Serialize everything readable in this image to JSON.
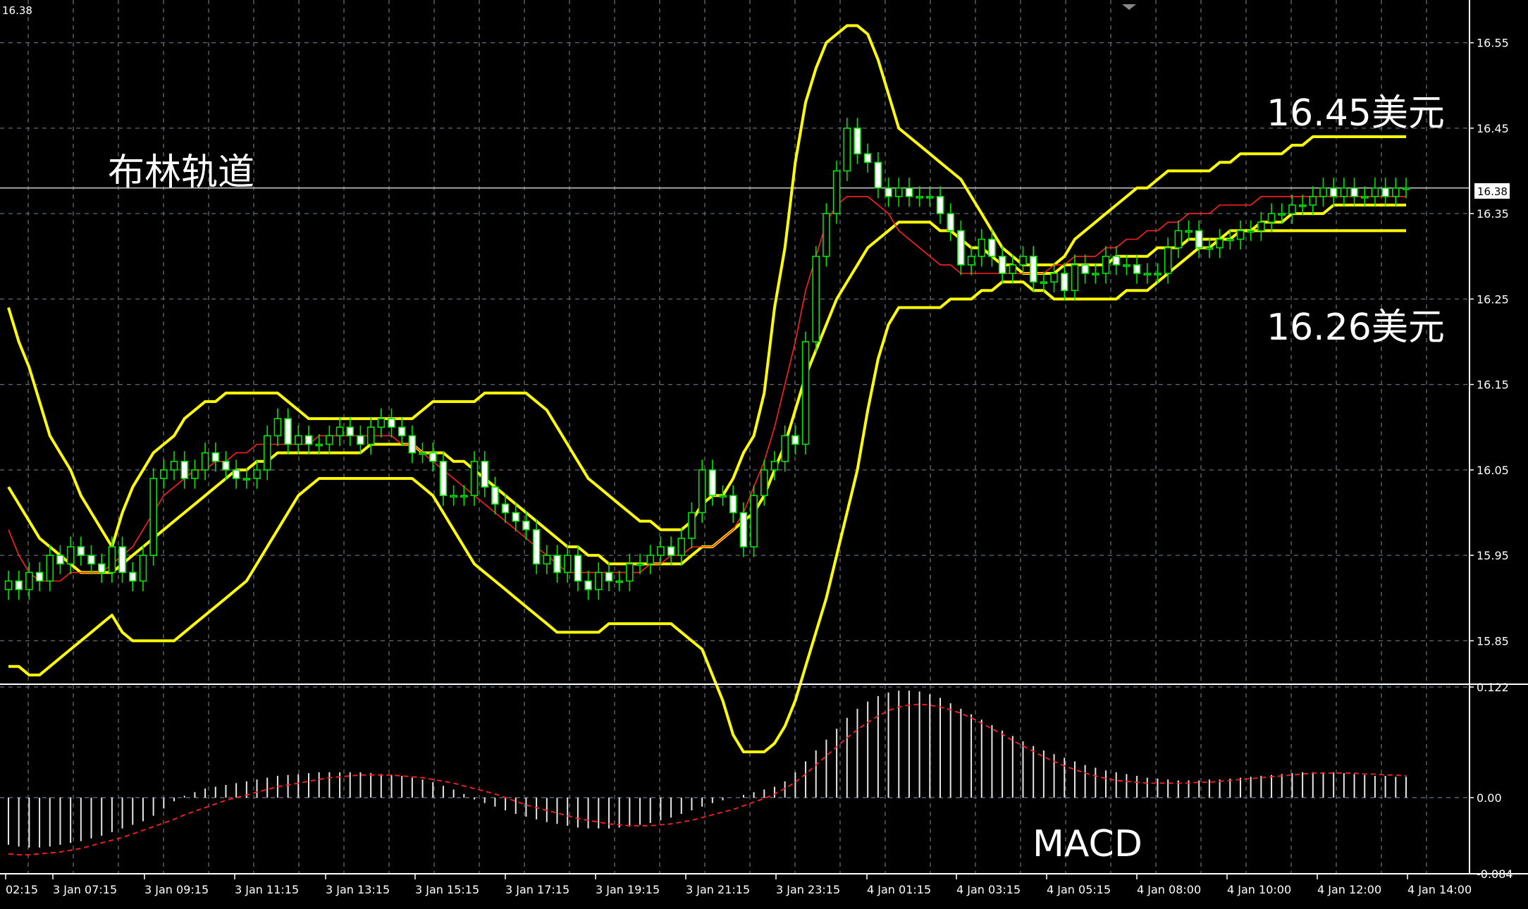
{
  "chart_data": [
    {
      "type": "candlestick",
      "corner_label": "16.38",
      "current_price": "16.38",
      "annotations": {
        "bollinger": "布林轨道",
        "upper_value": "16.45美元",
        "lower_value": "16.26美元"
      },
      "y_axis": {
        "range": [
          15.8,
          16.6
        ],
        "ticks": [
          "16.55",
          "16.45",
          "16.35",
          "16.25",
          "16.15",
          "16.05",
          "15.95",
          "15.85"
        ]
      },
      "x_axis": {
        "ticks": [
          "02:15",
          "3 Jan 07:15",
          "3 Jan 09:15",
          "3 Jan 11:15",
          "3 Jan 13:15",
          "3 Jan 15:15",
          "3 Jan 17:15",
          "3 Jan 19:15",
          "3 Jan 21:15",
          "3 Jan 23:15",
          "4 Jan 01:15",
          "4 Jan 03:15",
          "4 Jan 05:15",
          "4 Jan 08:00",
          "4 Jan 10:00",
          "4 Jan 12:00",
          "4 Jan 14:00"
        ]
      },
      "close": [
        15.92,
        15.91,
        15.93,
        15.92,
        15.95,
        15.94,
        15.96,
        15.95,
        15.94,
        15.93,
        15.96,
        15.93,
        15.92,
        15.95,
        16.04,
        16.05,
        16.06,
        16.04,
        16.05,
        16.07,
        16.06,
        16.05,
        16.04,
        16.04,
        16.05,
        16.09,
        16.11,
        16.08,
        16.09,
        16.08,
        16.08,
        16.09,
        16.1,
        16.09,
        16.08,
        16.1,
        16.11,
        16.1,
        16.09,
        16.07,
        16.07,
        16.06,
        16.02,
        16.02,
        16.02,
        16.06,
        16.03,
        16.01,
        16.0,
        15.99,
        15.98,
        15.94,
        15.95,
        15.93,
        15.95,
        15.92,
        15.91,
        15.93,
        15.92,
        15.92,
        15.94,
        15.94,
        15.95,
        15.96,
        15.95,
        15.97,
        16.0,
        16.05,
        16.02,
        16.02,
        16.0,
        15.96,
        16.02,
        16.05,
        16.06,
        16.09,
        16.08,
        16.2,
        16.3,
        16.35,
        16.4,
        16.45,
        16.42,
        16.41,
        16.38,
        16.37,
        16.38,
        16.37,
        16.37,
        16.37,
        16.35,
        16.33,
        16.29,
        16.3,
        16.32,
        16.3,
        16.28,
        16.29,
        16.3,
        16.27,
        16.27,
        16.28,
        16.26,
        16.29,
        16.28,
        16.28,
        16.3,
        16.29,
        16.29,
        16.28,
        16.28,
        16.28,
        16.31,
        16.33,
        16.33,
        16.31,
        16.31,
        16.32,
        16.32,
        16.33,
        16.33,
        16.34,
        16.35,
        16.35,
        16.36,
        16.36,
        16.37,
        16.38,
        16.37,
        16.38,
        16.37,
        16.37,
        16.38,
        16.37,
        16.38,
        16.38
      ],
      "series": [
        {
          "name": "upper",
          "color": "#ffff00",
          "values": [
            16.24,
            16.2,
            16.17,
            16.13,
            16.09,
            16.07,
            16.05,
            16.02,
            16.0,
            15.98,
            15.96,
            16.0,
            16.03,
            16.05,
            16.07,
            16.08,
            16.09,
            16.11,
            16.12,
            16.13,
            16.13,
            16.14,
            16.14,
            16.14,
            16.14,
            16.14,
            16.14,
            16.13,
            16.12,
            16.11,
            16.11,
            16.11,
            16.11,
            16.11,
            16.11,
            16.11,
            16.11,
            16.11,
            16.11,
            16.11,
            16.12,
            16.13,
            16.13,
            16.13,
            16.13,
            16.13,
            16.14,
            16.14,
            16.14,
            16.14,
            16.14,
            16.13,
            16.12,
            16.1,
            16.08,
            16.06,
            16.04,
            16.03,
            16.02,
            16.01,
            16.0,
            15.99,
            15.99,
            15.98,
            15.98,
            15.98,
            15.99,
            16.01,
            16.02,
            16.02,
            16.04,
            16.07,
            16.09,
            16.14,
            16.24,
            16.31,
            16.41,
            16.48,
            16.52,
            16.55,
            16.56,
            16.57,
            16.57,
            16.56,
            16.53,
            16.49,
            16.45,
            16.44,
            16.43,
            16.42,
            16.41,
            16.4,
            16.39,
            16.37,
            16.35,
            16.33,
            16.31,
            16.3,
            16.29,
            16.29,
            16.29,
            16.29,
            16.3,
            16.32,
            16.33,
            16.34,
            16.35,
            16.36,
            16.37,
            16.38,
            16.38,
            16.39,
            16.4,
            16.4,
            16.4,
            16.4,
            16.4,
            16.41,
            16.41,
            16.42,
            16.42,
            16.42,
            16.42,
            16.42,
            16.43,
            16.43,
            16.44,
            16.44,
            16.44,
            16.44,
            16.44,
            16.44,
            16.44,
            16.44,
            16.44,
            16.44
          ]
        },
        {
          "name": "middle",
          "color": "#ffff00",
          "values": [
            16.03,
            16.01,
            15.99,
            15.97,
            15.96,
            15.95,
            15.94,
            15.93,
            15.93,
            15.93,
            15.93,
            15.94,
            15.95,
            15.96,
            15.97,
            15.98,
            15.99,
            16.0,
            16.01,
            16.02,
            16.03,
            16.04,
            16.05,
            16.05,
            16.06,
            16.06,
            16.07,
            16.07,
            16.07,
            16.07,
            16.07,
            16.07,
            16.07,
            16.07,
            16.07,
            16.08,
            16.08,
            16.08,
            16.08,
            16.08,
            16.07,
            16.07,
            16.07,
            16.06,
            16.06,
            16.05,
            16.04,
            16.03,
            16.02,
            16.01,
            16.0,
            15.99,
            15.98,
            15.97,
            15.96,
            15.96,
            15.95,
            15.95,
            15.94,
            15.94,
            15.94,
            15.94,
            15.94,
            15.94,
            15.94,
            15.94,
            15.95,
            15.96,
            15.96,
            15.97,
            15.98,
            15.99,
            16.0,
            16.02,
            16.05,
            16.08,
            16.12,
            16.16,
            16.19,
            16.22,
            16.25,
            16.27,
            16.29,
            16.31,
            16.32,
            16.33,
            16.34,
            16.34,
            16.34,
            16.34,
            16.33,
            16.33,
            16.32,
            16.31,
            16.31,
            16.3,
            16.29,
            16.29,
            16.28,
            16.28,
            16.28,
            16.28,
            16.29,
            16.29,
            16.29,
            16.29,
            16.29,
            16.3,
            16.3,
            16.3,
            16.3,
            16.31,
            16.31,
            16.31,
            16.32,
            16.32,
            16.32,
            16.32,
            16.33,
            16.33,
            16.33,
            16.34,
            16.34,
            16.34,
            16.35,
            16.35,
            16.35,
            16.35,
            16.36,
            16.36,
            16.36,
            16.36,
            16.36,
            16.36,
            16.36,
            16.36
          ]
        },
        {
          "name": "lower",
          "color": "#ffff00",
          "values": [
            15.82,
            15.82,
            15.81,
            15.81,
            15.82,
            15.83,
            15.84,
            15.85,
            15.86,
            15.87,
            15.88,
            15.86,
            15.85,
            15.85,
            15.85,
            15.85,
            15.85,
            15.86,
            15.87,
            15.88,
            15.89,
            15.9,
            15.91,
            15.92,
            15.94,
            15.96,
            15.98,
            16.0,
            16.02,
            16.03,
            16.04,
            16.04,
            16.04,
            16.04,
            16.04,
            16.04,
            16.04,
            16.04,
            16.04,
            16.04,
            16.03,
            16.02,
            16.0,
            15.98,
            15.96,
            15.94,
            15.93,
            15.92,
            15.91,
            15.9,
            15.89,
            15.88,
            15.87,
            15.86,
            15.86,
            15.86,
            15.86,
            15.86,
            15.87,
            15.87,
            15.87,
            15.87,
            15.87,
            15.87,
            15.87,
            15.86,
            15.85,
            15.84,
            15.81,
            15.78,
            15.74,
            15.72,
            15.72,
            15.72,
            15.73,
            15.75,
            15.78,
            15.82,
            15.86,
            15.9,
            15.95,
            16.0,
            16.05,
            16.12,
            16.18,
            16.22,
            16.24,
            16.24,
            16.24,
            16.24,
            16.24,
            16.25,
            16.25,
            16.25,
            16.26,
            16.26,
            16.27,
            16.27,
            16.27,
            16.26,
            16.26,
            16.25,
            16.25,
            16.25,
            16.25,
            16.25,
            16.25,
            16.25,
            16.26,
            16.26,
            16.26,
            16.27,
            16.28,
            16.29,
            16.3,
            16.31,
            16.31,
            16.32,
            16.32,
            16.33,
            16.33,
            16.33,
            16.33,
            16.33,
            16.33,
            16.33,
            16.33,
            16.33,
            16.33,
            16.33,
            16.33,
            16.33,
            16.33,
            16.33,
            16.33,
            16.33
          ]
        },
        {
          "name": "ma",
          "color": "#ff2020",
          "values": [
            15.98,
            15.95,
            15.93,
            15.92,
            15.92,
            15.92,
            15.93,
            15.93,
            15.93,
            15.93,
            15.94,
            15.95,
            15.96,
            15.98,
            16.0,
            16.02,
            16.03,
            16.04,
            16.05,
            16.05,
            16.06,
            16.06,
            16.07,
            16.07,
            16.08,
            16.08,
            16.08,
            16.08,
            16.08,
            16.08,
            16.09,
            16.09,
            16.09,
            16.09,
            16.09,
            16.09,
            16.09,
            16.09,
            16.08,
            16.08,
            16.07,
            16.06,
            16.05,
            16.04,
            16.03,
            16.02,
            16.01,
            16.0,
            15.99,
            15.98,
            15.97,
            15.96,
            15.95,
            15.94,
            15.93,
            15.93,
            15.93,
            15.93,
            15.93,
            15.93,
            15.93,
            15.93,
            15.94,
            15.94,
            15.95,
            15.95,
            15.96,
            15.96,
            15.96,
            15.97,
            15.98,
            16.0,
            16.03,
            16.06,
            16.1,
            16.15,
            16.2,
            16.26,
            16.3,
            16.34,
            16.36,
            16.37,
            16.37,
            16.37,
            16.36,
            16.35,
            16.33,
            16.32,
            16.31,
            16.3,
            16.29,
            16.29,
            16.28,
            16.28,
            16.28,
            16.28,
            16.28,
            16.28,
            16.28,
            16.28,
            16.28,
            16.29,
            16.29,
            16.3,
            16.3,
            16.3,
            16.31,
            16.31,
            16.32,
            16.32,
            16.33,
            16.33,
            16.34,
            16.34,
            16.35,
            16.35,
            16.35,
            16.36,
            16.36,
            16.36,
            16.36,
            16.37,
            16.37,
            16.37,
            16.37,
            16.37,
            16.37,
            16.37,
            16.37,
            16.37,
            16.37,
            16.37,
            16.37,
            16.37,
            16.37,
            16.37
          ]
        }
      ]
    },
    {
      "type": "bar",
      "name_label": "MACD",
      "y_axis": {
        "range": [
          -0.084,
          0.122
        ],
        "ticks": [
          "0.122",
          "0.00",
          "-0.084"
        ]
      },
      "histogram": [
        -0.052,
        -0.054,
        -0.055,
        -0.055,
        -0.054,
        -0.052,
        -0.05,
        -0.048,
        -0.045,
        -0.042,
        -0.038,
        -0.034,
        -0.03,
        -0.026,
        -0.02,
        -0.012,
        -0.004,
        0.002,
        0.006,
        0.01,
        0.012,
        0.014,
        0.016,
        0.018,
        0.02,
        0.022,
        0.024,
        0.025,
        0.026,
        0.027,
        0.028,
        0.028,
        0.028,
        0.028,
        0.028,
        0.027,
        0.026,
        0.025,
        0.024,
        0.022,
        0.02,
        0.017,
        0.013,
        0.009,
        0.004,
        -0.002,
        -0.006,
        -0.01,
        -0.014,
        -0.018,
        -0.021,
        -0.024,
        -0.027,
        -0.029,
        -0.031,
        -0.033,
        -0.034,
        -0.034,
        -0.034,
        -0.033,
        -0.032,
        -0.03,
        -0.028,
        -0.025,
        -0.022,
        -0.018,
        -0.014,
        -0.01,
        -0.006,
        -0.003,
        0.0,
        0.003,
        0.006,
        0.009,
        0.012,
        0.018,
        0.028,
        0.04,
        0.052,
        0.064,
        0.076,
        0.088,
        0.098,
        0.106,
        0.112,
        0.116,
        0.118,
        0.118,
        0.117,
        0.114,
        0.11,
        0.104,
        0.098,
        0.092,
        0.086,
        0.08,
        0.074,
        0.068,
        0.062,
        0.057,
        0.052,
        0.048,
        0.044,
        0.04,
        0.036,
        0.033,
        0.03,
        0.028,
        0.026,
        0.024,
        0.022,
        0.021,
        0.02,
        0.019,
        0.019,
        0.019,
        0.02,
        0.02,
        0.021,
        0.022,
        0.023,
        0.024,
        0.025,
        0.026,
        0.027,
        0.028,
        0.028,
        0.028,
        0.028,
        0.027,
        0.026,
        0.025,
        0.024,
        0.024,
        0.023,
        0.023
      ],
      "signal": [
        -0.062,
        -0.063,
        -0.063,
        -0.062,
        -0.061,
        -0.06,
        -0.058,
        -0.056,
        -0.053,
        -0.05,
        -0.047,
        -0.044,
        -0.04,
        -0.036,
        -0.032,
        -0.028,
        -0.024,
        -0.019,
        -0.015,
        -0.011,
        -0.007,
        -0.003,
        0.0,
        0.003,
        0.006,
        0.009,
        0.012,
        0.014,
        0.016,
        0.018,
        0.02,
        0.022,
        0.023,
        0.024,
        0.025,
        0.025,
        0.025,
        0.025,
        0.024,
        0.023,
        0.022,
        0.02,
        0.018,
        0.016,
        0.013,
        0.01,
        0.007,
        0.004,
        0.0,
        -0.004,
        -0.008,
        -0.011,
        -0.014,
        -0.017,
        -0.02,
        -0.023,
        -0.025,
        -0.027,
        -0.029,
        -0.03,
        -0.031,
        -0.031,
        -0.031,
        -0.03,
        -0.029,
        -0.027,
        -0.025,
        -0.022,
        -0.019,
        -0.016,
        -0.013,
        -0.009,
        -0.005,
        -0.001,
        0.004,
        0.01,
        0.017,
        0.026,
        0.036,
        0.046,
        0.056,
        0.066,
        0.075,
        0.083,
        0.09,
        0.096,
        0.1,
        0.102,
        0.103,
        0.102,
        0.1,
        0.097,
        0.093,
        0.088,
        0.082,
        0.076,
        0.07,
        0.063,
        0.057,
        0.051,
        0.045,
        0.04,
        0.035,
        0.031,
        0.027,
        0.024,
        0.021,
        0.019,
        0.018,
        0.017,
        0.016,
        0.016,
        0.016,
        0.016,
        0.016,
        0.017,
        0.017,
        0.018,
        0.019,
        0.02,
        0.021,
        0.022,
        0.023,
        0.024,
        0.025,
        0.026,
        0.027,
        0.027,
        0.027,
        0.027,
        0.027,
        0.026,
        0.026,
        0.025,
        0.025,
        0.024
      ]
    }
  ]
}
